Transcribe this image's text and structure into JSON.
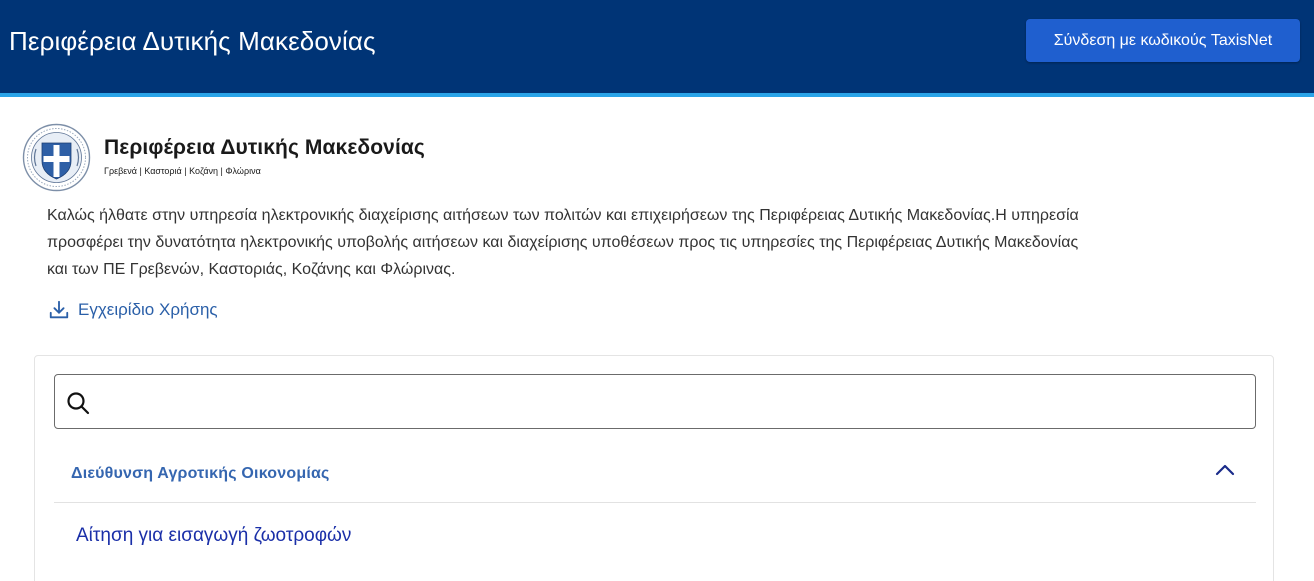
{
  "header": {
    "title": "Περιφέρεια Δυτικής Μακεδονίας",
    "login_label": "Σύνδεση με κωδικούς TaxisNet"
  },
  "logo": {
    "title": "Περιφέρεια Δυτικής Μακεδονίας",
    "subtitle": "Γρεβενά | Καστοριά | Κοζάνη | Φλώρινα"
  },
  "intro": {
    "lines": [
      "Καλώς ήλθατε στην υπηρεσία ηλεκτρονικής διαχείρισης αιτήσεων των πολιτών και επιχειρήσεων της Περιφέρειας Δυτικής Μακεδονίας.Η υπηρεσία",
      "προσφέρει την δυνατότητα ηλεκτρονικής υποβολής αιτήσεων και διαχείρισης υποθέσεων προς τις υπηρεσίες της Περιφέρειας Δυτικής Μακεδονίας",
      "και των ΠΕ Γρεβενών, Καστοριάς, Κοζάνης και Φλώρινας."
    ]
  },
  "manual": {
    "label": "Εγχειρίδιο Χρήσης",
    "icon": "download-icon"
  },
  "search": {
    "value": "",
    "placeholder": "",
    "icon": "search-icon"
  },
  "accordion": {
    "section_title": "Διεύθυνση Αγροτικής Οικονομίας",
    "expanded": true,
    "items": [
      {
        "label": "Αίτηση για εισαγωγή ζωοτροφών"
      }
    ]
  },
  "colors": {
    "header_bg": "#003476",
    "header_accent": "#2aa4e8",
    "login_button": "#1f5fcf",
    "link": "#2a5fa8",
    "section_title": "#3566b0",
    "item_link": "#1a2fa8"
  }
}
